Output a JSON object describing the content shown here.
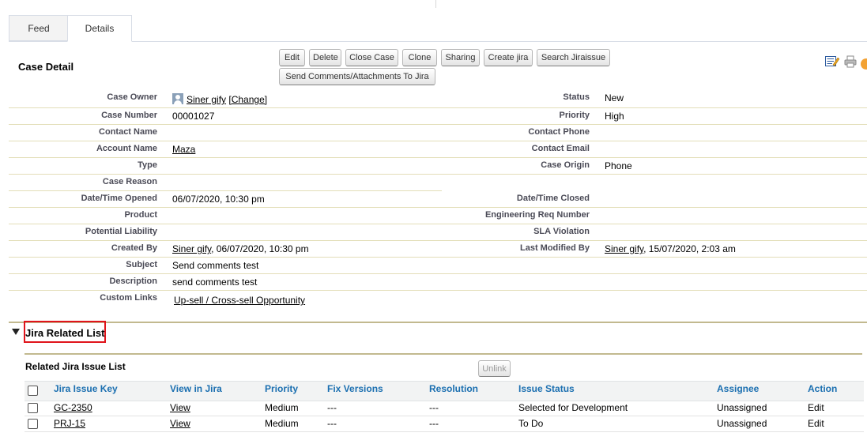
{
  "tabs": {
    "feed": "Feed",
    "details": "Details"
  },
  "case_detail": {
    "title": "Case Detail",
    "buttons": {
      "edit": "Edit",
      "delete": "Delete",
      "close_case": "Close Case",
      "clone": "Clone",
      "sharing": "Sharing",
      "create_jira": "Create jira",
      "search_jira": "Search Jiraissue",
      "send_comments": "Send Comments/Attachments To Jira"
    }
  },
  "fields": {
    "case_owner_label": "Case Owner",
    "case_owner_value": "Siner gify",
    "case_owner_change": "[Change]",
    "status_label": "Status",
    "status_value": "New",
    "case_number_label": "Case Number",
    "case_number_value": "00001027",
    "priority_label": "Priority",
    "priority_value": "High",
    "contact_name_label": "Contact Name",
    "contact_phone_label": "Contact Phone",
    "account_name_label": "Account Name",
    "account_name_value": "Maza",
    "contact_email_label": "Contact Email",
    "type_label": "Type",
    "case_origin_label": "Case Origin",
    "case_origin_value": "Phone",
    "case_reason_label": "Case Reason",
    "date_opened_label": "Date/Time Opened",
    "date_opened_value": "06/07/2020, 10:30 pm",
    "date_closed_label": "Date/Time Closed",
    "product_label": "Product",
    "eng_req_label": "Engineering Req Number",
    "liability_label": "Potential Liability",
    "sla_label": "SLA Violation",
    "created_by_label": "Created By",
    "created_by_user": "Siner gify",
    "created_by_date": ", 06/07/2020, 10:30 pm",
    "modified_by_label": "Last Modified By",
    "modified_by_user": "Siner gify",
    "modified_by_date": ", 15/07/2020, 2:03 am",
    "subject_label": "Subject",
    "subject_value": "Send comments test",
    "description_label": "Description",
    "description_value": "send comments test",
    "custom_links_label": "Custom Links",
    "custom_links_value": "Up-sell / Cross-sell Opportunity"
  },
  "jira": {
    "section_title": "Jira Related List",
    "list_title": "Related Jira Issue List",
    "unlink": "Unlink",
    "columns": {
      "key": "Jira Issue Key",
      "view": "View in Jira",
      "priority": "Priority",
      "versions": "Fix Versions",
      "resolution": "Resolution",
      "status": "Issue Status",
      "assignee": "Assignee",
      "action": "Action"
    },
    "rows": [
      {
        "key": "GC-2350",
        "view": "View",
        "priority": "Medium",
        "versions": "---",
        "resolution": "---",
        "status": "Selected for Development",
        "assignee": "Unassigned",
        "action": "Edit"
      },
      {
        "key": "PRJ-15",
        "view": "View",
        "priority": "Medium",
        "versions": "---",
        "resolution": "---",
        "status": "To Do",
        "assignee": "Unassigned",
        "action": "Edit"
      }
    ]
  }
}
